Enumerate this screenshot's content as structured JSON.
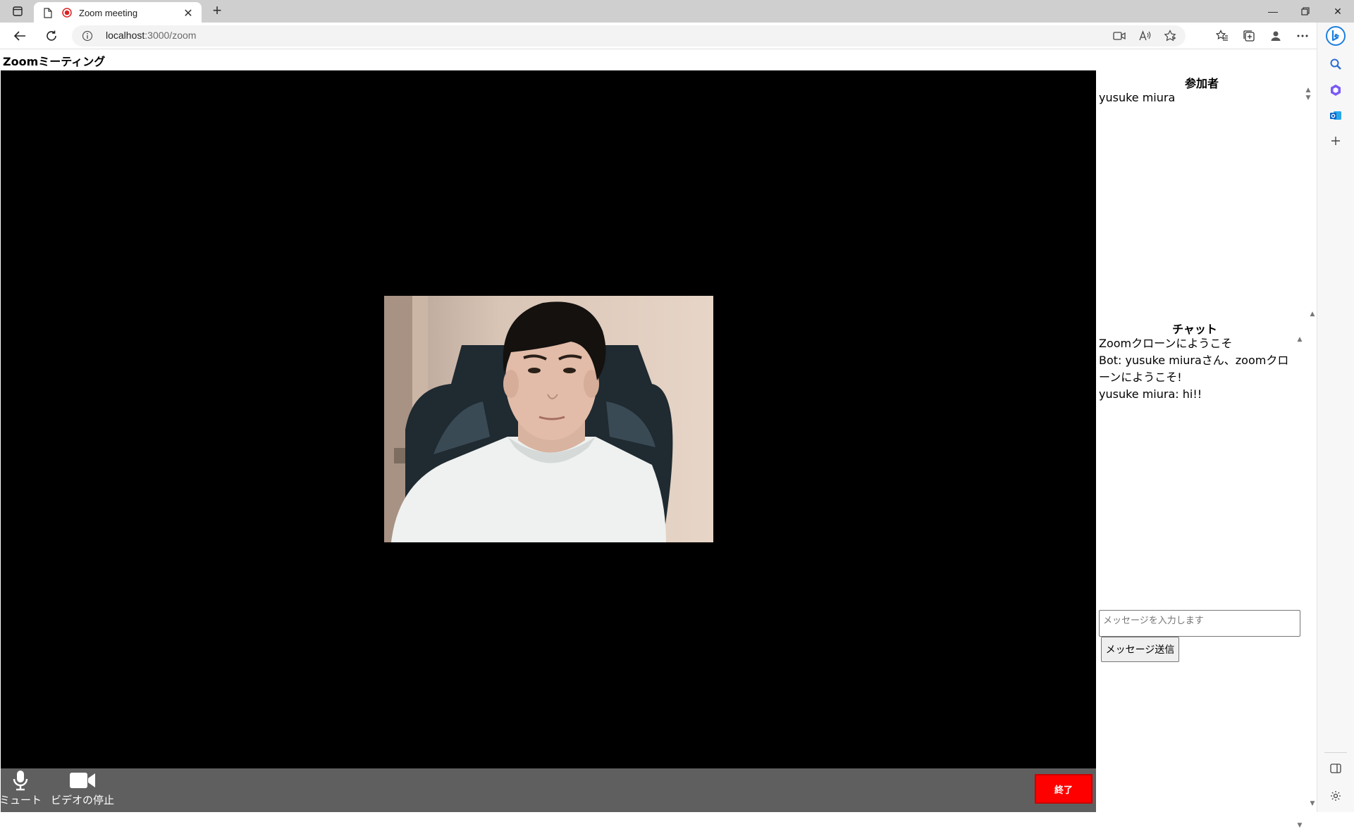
{
  "browser": {
    "tab_title": "Zoom meeting",
    "address_host": "localhost",
    "address_path": ":3000/zoom"
  },
  "page": {
    "title": "Zoomミーティング"
  },
  "controls": {
    "mute_label": "ミュート",
    "video_stop_label": "ビデオの停止",
    "end_label": "終了"
  },
  "participants": {
    "heading": "参加者",
    "items": [
      "yusuke miura"
    ]
  },
  "chat": {
    "heading": "チャット",
    "messages": [
      "Zoomクローンにようこそ",
      "Bot: yusuke miuraさん、zoomクローンにようこそ!",
      "yusuke miura: hi!!"
    ],
    "input_placeholder": "メッセージを入力します",
    "send_label": "メッセージ送信"
  },
  "colors": {
    "end_button": "#ff0000",
    "control_bar": "#5f5f5f",
    "video_background": "#000000"
  }
}
